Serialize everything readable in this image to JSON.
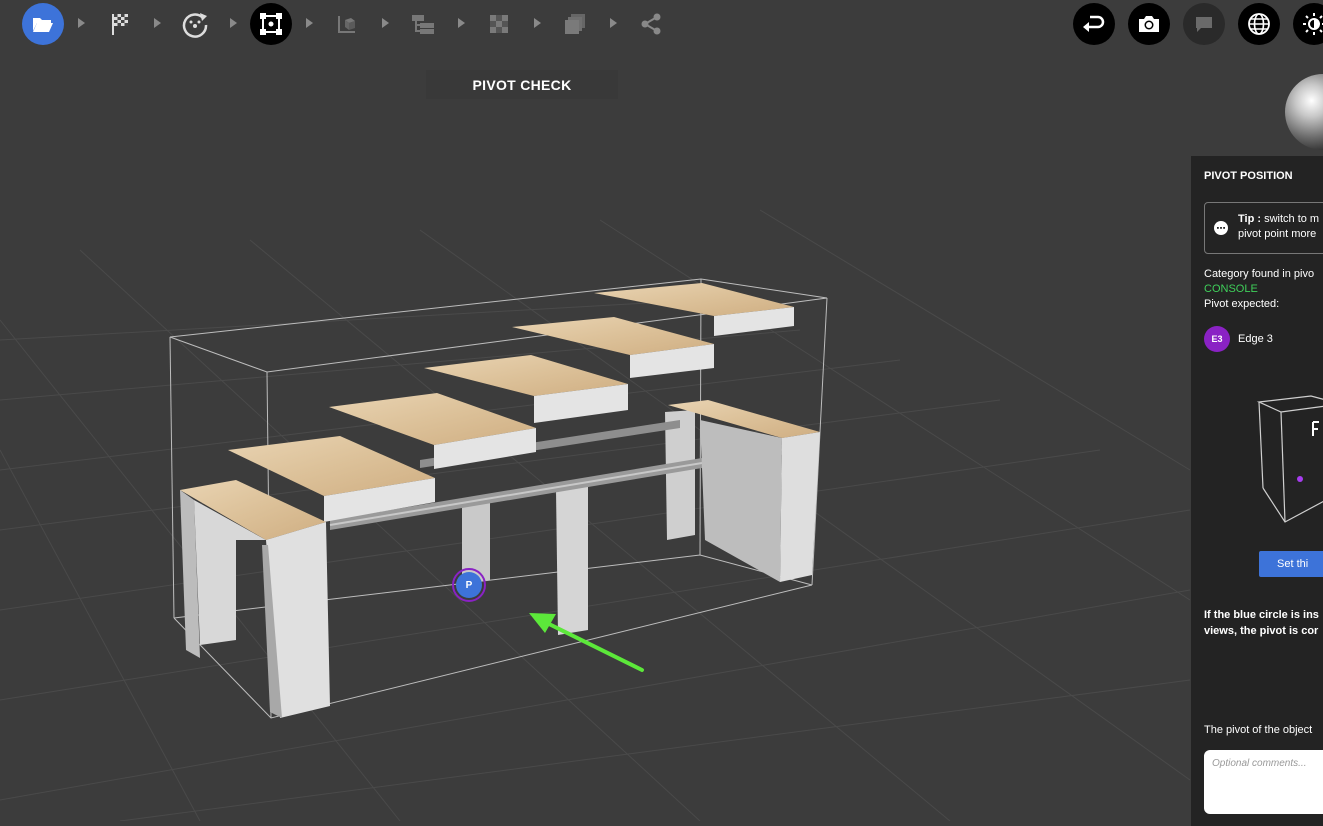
{
  "viewport_title": "PIVOT CHECK",
  "pivot_marker_label": "P",
  "toolbar": {
    "steps": [
      "open-folder-icon",
      "finish-flag-icon",
      "rotate-check-icon",
      "pivot-frame-icon",
      "cube-axis-icon",
      "hierarchy-icon",
      "checker-texture-icon",
      "layers-icon",
      "share-icon"
    ],
    "right": [
      "undo-icon",
      "camera-icon",
      "comment-icon",
      "globe-icon",
      "lighting-icon"
    ]
  },
  "panel": {
    "title": "PIVOT POSITION",
    "tip_label": "Tip :",
    "tip_text_line1": "switch to m",
    "tip_text_line2": "pivot point more",
    "category_label": "Category found in pivo",
    "category_value": "CONSOLE",
    "pivot_expected_label": "Pivot expected:",
    "edge_badge": "E3",
    "edge_name": "Edge 3",
    "set_button_label": "Set thi",
    "instruction_line1": "If the blue circle  is ins",
    "instruction_line2": "views, the pivot is cor",
    "pivot_object_label": "The pivot of the object",
    "comments_placeholder": "Optional comments..."
  },
  "colors": {
    "accent_blue": "#3d73d9",
    "edge_purple": "#8a22c4",
    "category_green": "#3fcf5a",
    "arrow_green": "#5ce83a"
  }
}
